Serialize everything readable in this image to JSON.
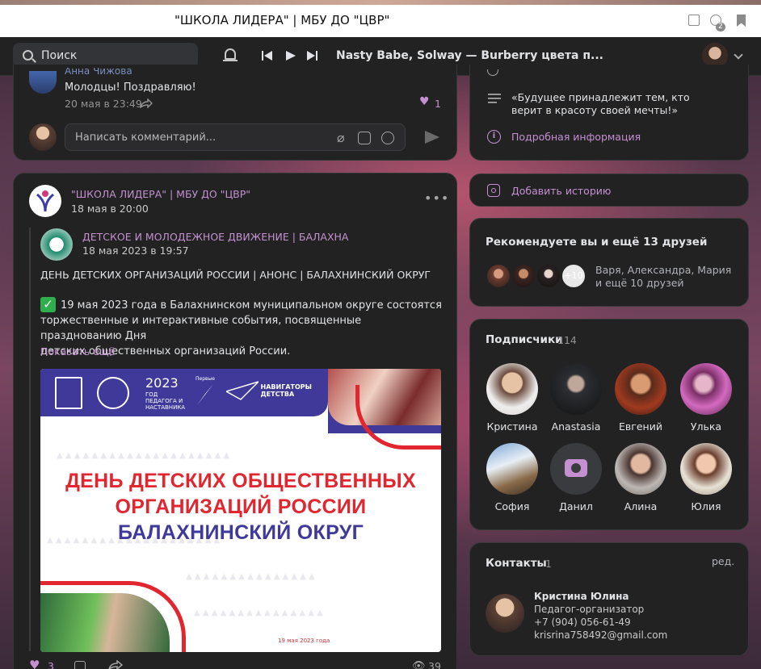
{
  "window": {
    "title": "\"ШКОЛА ЛИДЕРА\" | МБУ ДО \"ЦВР\"",
    "badge": "2"
  },
  "nav": {
    "search_placeholder": "Поиск",
    "track": "Nasty Babe, Solway — Burberry цвета п..."
  },
  "prev_comment": {
    "author": "Анна Чижова",
    "text": "Молодцы! Поздравляю!",
    "date": "20 мая в 23:49",
    "likes": "1",
    "input_placeholder": "Написать комментарий..."
  },
  "post": {
    "author": "\"ШКОЛА ЛИДЕРА\" | МБУ ДО \"ЦВР\"",
    "date": "18 мая в 20:00",
    "repost_author": "ДЕТСКОЕ И МОЛОДЕЖНОЕ ДВИЖЕНИЕ | БАЛАХНА",
    "repost_date": "18 мая 2023 в 19:57",
    "headline": "ДЕНЬ ДЕТСКИХ ОРГАНИЗАЦИЙ РОССИИ | АНОНС | БАЛАХНИНСКИЙ ОКРУГ",
    "check": "✅",
    "body_lines": [
      "19 мая 2023 года в Балахнинском муниципальном округе состоятся",
      "торжественные и интерактивные события, посвященные празднованию Дня",
      "детских общественных организаций России."
    ],
    "show_more": "Показать ещё",
    "poster": {
      "line1": "ДЕНЬ ДЕТСКИХ ОБЩЕСТВЕННЫХ",
      "line2": "ОРГАНИЗАЦИЙ РОССИИ",
      "line3": "БАЛАХНИНСКИЙ ОКРУГ",
      "date": "19 мая 2023 года",
      "logo_year": "2023",
      "logo_year_text": "ГОД ПЕДАГОГА И НАСТАВНИКА",
      "logo_first": "Первые",
      "logo_nav": "НАВИГАТОРЫ ДЕТСТВА"
    },
    "likes": "3",
    "views": "39"
  },
  "about": {
    "quote": "«Будущее принадлежит тем, кто верит в красоту своей мечты!»",
    "details": "Подробная информация"
  },
  "story": {
    "label": "Добавить историю"
  },
  "recommend": {
    "title": "Рекомендуете вы и ещё 13 друзей",
    "more": "+10",
    "names": "Варя, Александра, Мария",
    "tail": "и ещё 10 друзей"
  },
  "subscribers": {
    "title": "Подписчики",
    "count": "114",
    "items": [
      {
        "name": "Кристина"
      },
      {
        "name": "Anastasia"
      },
      {
        "name": "Евгений"
      },
      {
        "name": "Улька"
      },
      {
        "name": "София"
      },
      {
        "name": "Данил"
      },
      {
        "name": "Алина"
      },
      {
        "name": "Юлия"
      }
    ]
  },
  "contacts": {
    "title": "Контакты",
    "count": "1",
    "edit": "ред.",
    "name": "Кристина Юлина",
    "role": "Педагог-организатор",
    "phone": "+7 (904) 056-61-49",
    "email": "krisrina758492@gmail.com"
  },
  "colors": {
    "accent": "#c490d1",
    "card": "#222222",
    "red": "#e2262f",
    "indigo": "#3f3a99"
  }
}
